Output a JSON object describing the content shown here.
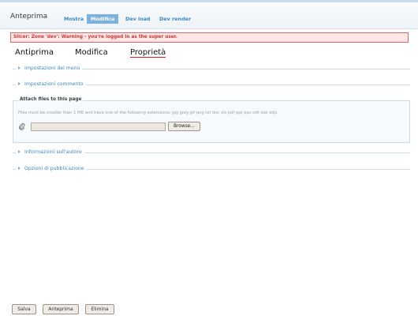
{
  "header": {
    "title": "Anteprima",
    "tabs": [
      {
        "label": "Mostra"
      },
      {
        "label": "Modifica"
      },
      {
        "label": "Dev load"
      },
      {
        "label": "Dev render"
      }
    ]
  },
  "alert": {
    "text": "Slicer: Zone 'dev': Warning - you're logged in as the super user."
  },
  "subtabs": [
    {
      "label": "Antiprima"
    },
    {
      "label": "Modifica"
    },
    {
      "label": "Proprietà"
    }
  ],
  "sections": {
    "menu": "Impostazioni del menù",
    "comment": "Impostazioni commento",
    "author": "Informazioni sull'autore",
    "publishing": "Opzioni di pubblicazione"
  },
  "attach": {
    "legend": "Attach files to this page",
    "description": "Files must be smaller than 1 MB and have one of the following extensions: jpg jpeg gif png txt doc xls pdf ppt pps odt ods odp.",
    "browse_label": "Browse...",
    "file_value": ""
  },
  "footer": {
    "save": "Salva",
    "preview": "Anteprima",
    "delete": "Elimina"
  },
  "colors": {
    "accent": "#3d88c2",
    "active_tab": "#7fb2da",
    "alert_text": "#c23b3b"
  }
}
